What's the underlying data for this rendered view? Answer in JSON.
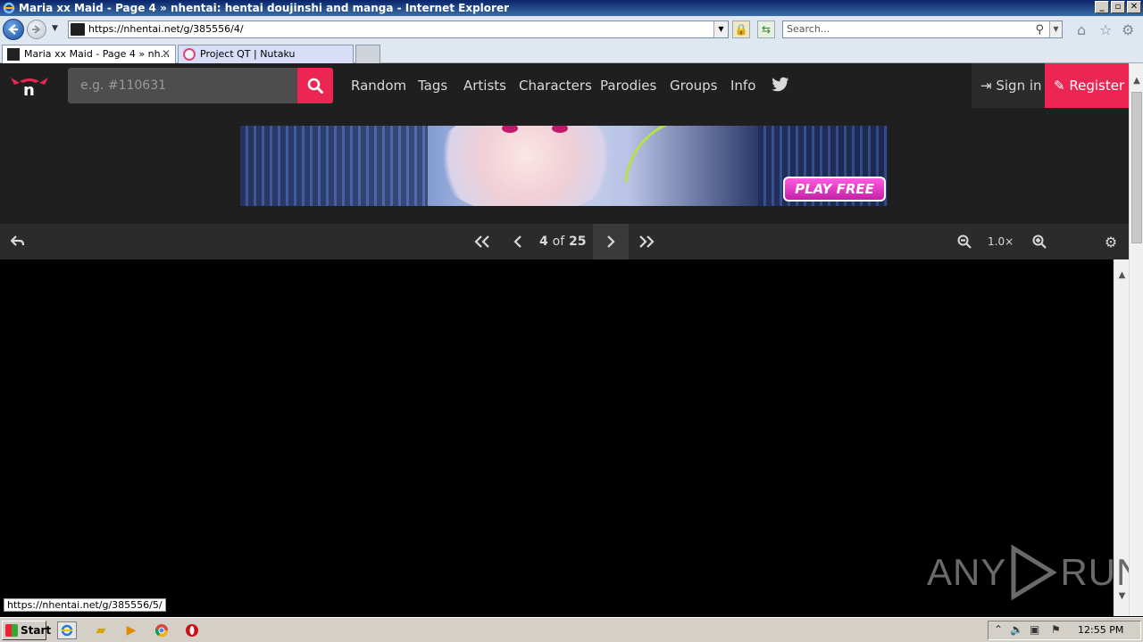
{
  "window": {
    "title": "Maria xx Maid - Page 4 » nhentai: hentai doujinshi and manga - Internet Explorer",
    "controls": [
      "_",
      "▫",
      "✕"
    ]
  },
  "addressbar": {
    "url": "https://nhentai.net/g/385556/4/",
    "search_placeholder": "Search..."
  },
  "tabs": [
    {
      "label": "Maria xx Maid - Page 4 » nh...",
      "active": true
    },
    {
      "label": "Project QT | Nutaku",
      "active": false
    }
  ],
  "site": {
    "search_placeholder": "e.g. #110631",
    "nav": [
      "Random",
      "Tags",
      "Artists",
      "Characters",
      "Parodies",
      "Groups",
      "Info"
    ],
    "signin_label": "Sign in",
    "register_label": "Register",
    "accent_color": "#ed2553"
  },
  "banner": {
    "cta_label": "PLAY FREE"
  },
  "reader": {
    "current_page": "4",
    "of_label": "of",
    "total_pages": "25",
    "zoom": "1.0×"
  },
  "status": {
    "hover_url": "https://nhentai.net/g/385556/5/"
  },
  "watermark": {
    "left": "ANY",
    "right": "RUN"
  },
  "taskbar": {
    "start_label": "Start",
    "clock": "12:55 PM"
  }
}
